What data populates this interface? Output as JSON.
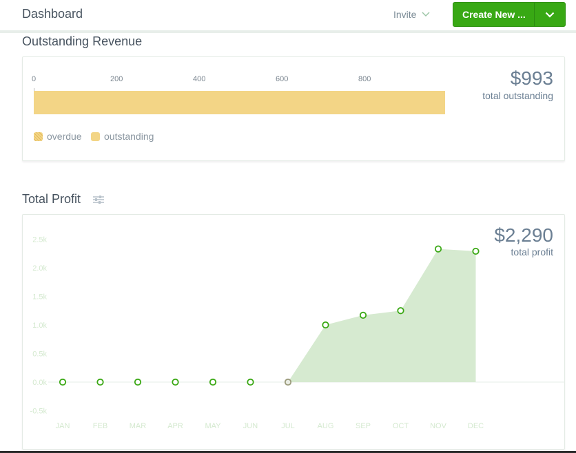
{
  "header": {
    "title": "Dashboard",
    "invite_label": "Invite",
    "create_label": "Create New ..."
  },
  "revenue": {
    "title": "Outstanding Revenue",
    "amount": "$993",
    "amount_label": "total outstanding",
    "axis_ticks": [
      "0",
      "200",
      "400",
      "600",
      "800"
    ],
    "legend": [
      {
        "label": "overdue",
        "icon": "dotted-swatch"
      },
      {
        "label": "outstanding",
        "icon": "solid-swatch"
      }
    ],
    "colors": {
      "outstanding": "#f3d586",
      "overdue": "#e2b95a"
    }
  },
  "profit": {
    "title": "Total Profit",
    "amount": "$2,290",
    "amount_label": "total profit"
  },
  "chart_data": {
    "type": "area",
    "categories": [
      "JAN",
      "FEB",
      "MAR",
      "APR",
      "MAY",
      "JUN",
      "JUL",
      "AUG",
      "SEP",
      "OCT",
      "NOV",
      "DEC"
    ],
    "y_ticks": [
      "2.5k",
      "2.0k",
      "1.5k",
      "1.0k",
      "0.5k",
      "0.0k",
      "-0.5k"
    ],
    "ylim": [
      -0.5,
      2.5
    ],
    "series": [
      {
        "values": [
          0,
          0,
          0,
          0,
          0,
          0,
          0,
          1.0,
          1.17,
          1.25,
          2.33,
          2.29
        ]
      }
    ],
    "colors": {
      "fill": "#d6ead0",
      "point": "#3aa814"
    }
  }
}
